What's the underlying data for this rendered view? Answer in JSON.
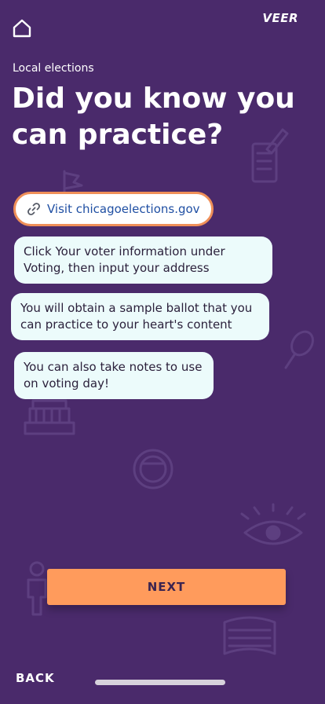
{
  "header": {
    "home_icon": "home-icon",
    "brand": "VEER"
  },
  "content": {
    "eyebrow": "Local elections",
    "title": "Did you know you can practice?",
    "link": {
      "icon": "link-icon",
      "label": "Visit chicagoelections.gov"
    },
    "bubbles": [
      "Click Your voter information under Voting, then input your address",
      "You will obtain a sample ballot that you can practice to your heart's content",
      "You can also take notes to use on voting day!"
    ]
  },
  "footer": {
    "next_label": "NEXT",
    "back_label": "BACK"
  },
  "colors": {
    "background": "#4a2a6b",
    "accent": "#ff9b5c",
    "bubble": "#ecfbfb",
    "link": "#1f4fa3"
  }
}
